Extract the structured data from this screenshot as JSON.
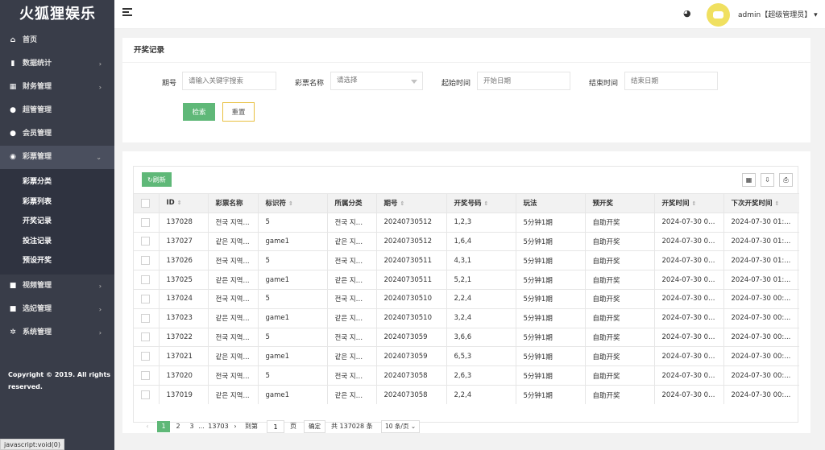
{
  "app": {
    "logo": "火狐狸娱乐"
  },
  "sidebar": {
    "items": [
      {
        "label": "首页",
        "icon": "home-icon",
        "glyph": "⌂",
        "arrow": ""
      },
      {
        "label": "数据统计",
        "icon": "bar-chart-icon",
        "glyph": "▮",
        "arrow": "›"
      },
      {
        "label": "财务管理",
        "icon": "bank-icon",
        "glyph": "▦",
        "arrow": "›"
      },
      {
        "label": "超管管理",
        "icon": "user-icon",
        "glyph": "●",
        "arrow": ""
      },
      {
        "label": "会员管理",
        "icon": "users-icon",
        "glyph": "●",
        "arrow": ""
      },
      {
        "label": "彩票管理",
        "icon": "gamepad-icon",
        "glyph": "◉",
        "arrow": "⌄"
      }
    ],
    "subitems": [
      "彩票分类",
      "彩票列表",
      "开奖记录",
      "投注记录",
      "预设开奖"
    ],
    "items_after": [
      {
        "label": "视频管理",
        "icon": "video-icon",
        "glyph": "■",
        "arrow": "›"
      },
      {
        "label": "选妃管理",
        "icon": "camera-icon",
        "glyph": "■",
        "arrow": "›"
      },
      {
        "label": "系统管理",
        "icon": "gear-icon",
        "glyph": "✲",
        "arrow": "›"
      }
    ],
    "copyright_line1": "Copyright © 2019. All rights",
    "copyright_line2": "reserved."
  },
  "statusbar": "javascript:void(0)",
  "header": {
    "user": "admin【超级管理员】",
    "user_caret": "▾"
  },
  "filter": {
    "title": "开奖记录",
    "fields": [
      {
        "label": "期号",
        "placeholder": "请输入关键字搜索"
      },
      {
        "label": "彩票名称",
        "placeholder": "请选择"
      },
      {
        "label": "起始时间",
        "placeholder": "开始日期"
      },
      {
        "label": "结束时间",
        "placeholder": "结束日期"
      }
    ],
    "search_label": "检索",
    "reset_label": "重置"
  },
  "table": {
    "refresh_label": "刷新",
    "tools": [
      "▦",
      "⇩",
      "⎙"
    ],
    "columns": [
      "ID",
      "彩票名称",
      "标识符",
      "所属分类",
      "期号",
      "开奖号码",
      "玩法",
      "预开奖",
      "开奖时间",
      "下次开奖时间"
    ],
    "sortable": [
      true,
      false,
      true,
      false,
      true,
      true,
      false,
      false,
      true,
      true
    ],
    "rows": [
      [
        "137028",
        "전국 지역...",
        "5",
        "전국 지역...",
        "20240730512",
        "1,2,3",
        "5分钟1期",
        "自助开奖",
        "2024-07-30 01:...",
        "2024-07-30 01:..."
      ],
      [
        "137027",
        "같은 지역...",
        "game1",
        "같은 지역...",
        "20240730512",
        "1,6,4",
        "5分钟1期",
        "自助开奖",
        "2024-07-30 01:...",
        "2024-07-30 01:..."
      ],
      [
        "137026",
        "전국 지역...",
        "5",
        "전국 지역...",
        "20240730511",
        "4,3,1",
        "5分钟1期",
        "自助开奖",
        "2024-07-30 00:...",
        "2024-07-30 01:..."
      ],
      [
        "137025",
        "같은 지역...",
        "game1",
        "같은 지역...",
        "20240730511",
        "5,2,1",
        "5分钟1期",
        "自助开奖",
        "2024-07-30 00:...",
        "2024-07-30 01:..."
      ],
      [
        "137024",
        "전국 지역...",
        "5",
        "전국 지역...",
        "20240730510",
        "2,2,4",
        "5分钟1期",
        "自助开奖",
        "2024-07-30 00:...",
        "2024-07-30 00:..."
      ],
      [
        "137023",
        "같은 지역...",
        "game1",
        "같은 지역...",
        "20240730510",
        "3,2,4",
        "5分钟1期",
        "自助开奖",
        "2024-07-30 00:...",
        "2024-07-30 00:..."
      ],
      [
        "137022",
        "전국 지역...",
        "5",
        "전국 지역...",
        "2024073059",
        "3,6,6",
        "5分钟1期",
        "自助开奖",
        "2024-07-30 00:...",
        "2024-07-30 00:..."
      ],
      [
        "137021",
        "같은 지역...",
        "game1",
        "같은 지역...",
        "2024073059",
        "6,5,3",
        "5分钟1期",
        "自助开奖",
        "2024-07-30 00:...",
        "2024-07-30 00:..."
      ],
      [
        "137020",
        "전국 지역...",
        "5",
        "전국 지역...",
        "2024073058",
        "2,6,3",
        "5分钟1期",
        "自助开奖",
        "2024-07-30 00:...",
        "2024-07-30 00:..."
      ],
      [
        "137019",
        "같은 지역...",
        "game1",
        "같은 지역...",
        "2024073058",
        "2,2,4",
        "5分钟1期",
        "自助开奖",
        "2024-07-30 00:...",
        "2024-07-30 00:..."
      ]
    ]
  },
  "pager": {
    "prev": "‹",
    "pages": [
      "1",
      "2",
      "3"
    ],
    "ellipsis": "...",
    "last": "13703",
    "next": "›",
    "goto_label": "到第",
    "goto_value": "1",
    "page_suffix": "页",
    "confirm": "确定",
    "total": "共 137028 条",
    "per_page": "10 条/页"
  },
  "colors": {
    "sidebar": "#393d49",
    "accent": "#5fb878",
    "reset_border": "#e8c040"
  }
}
